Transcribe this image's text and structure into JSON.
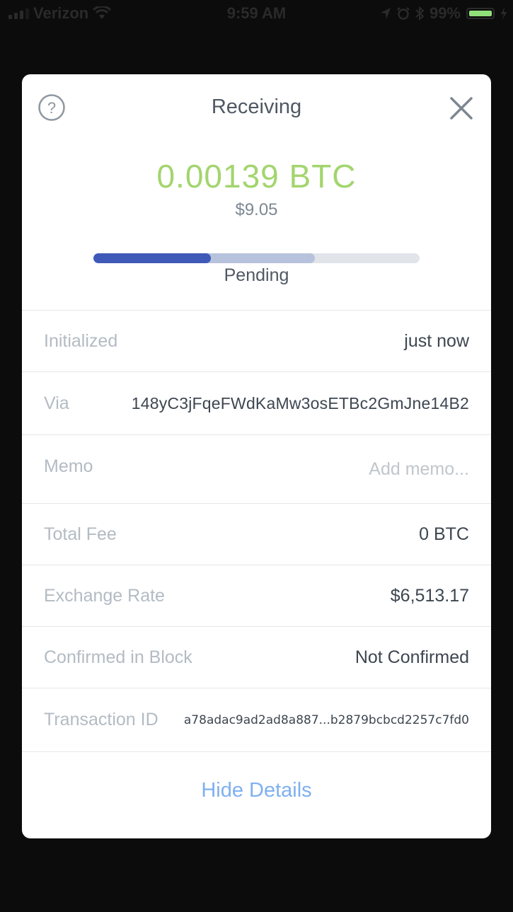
{
  "status_bar": {
    "carrier": "Verizon",
    "time": "9:59 AM",
    "battery_percent": "99%",
    "battery_level": 0.99,
    "battery_color": "#8fe07a",
    "icons": [
      "signal-icon",
      "wifi-icon",
      "location-arrow-icon",
      "alarm-icon",
      "bluetooth-icon",
      "battery-icon",
      "charging-icon"
    ]
  },
  "modal": {
    "title": "Receiving",
    "help_icon": "question-circle-icon",
    "close_icon": "close-icon",
    "amount_crypto": "0.00139 BTC",
    "amount_fiat": "$9.05",
    "amount_color": "#a3d56e",
    "progress": {
      "label": "Pending",
      "filled_fraction": 0.36,
      "buffered_fraction": 0.68,
      "fill_color": "#3f59b8",
      "buffer_color": "#b7c3dd"
    },
    "details": [
      {
        "key": "initialized",
        "label": "Initialized",
        "value": "just now"
      },
      {
        "key": "via",
        "label": "Via",
        "value": "148yC3jFqeFWdKaMw3osETBc2GmJne14B2"
      },
      {
        "key": "memo",
        "label": "Memo",
        "value": "Add memo..."
      },
      {
        "key": "total-fee",
        "label": "Total Fee",
        "value": "0 BTC"
      },
      {
        "key": "exchange-rate",
        "label": "Exchange Rate",
        "value": "$6,513.17"
      },
      {
        "key": "confirmed-in-block",
        "label": "Confirmed in Block",
        "value": "Not Confirmed"
      },
      {
        "key": "transaction-id",
        "label": "Transaction ID",
        "value": "a78adac9ad2ad8a887...b2879bcbcd2257c7fd0"
      }
    ],
    "hide_details_label": "Hide Details"
  }
}
